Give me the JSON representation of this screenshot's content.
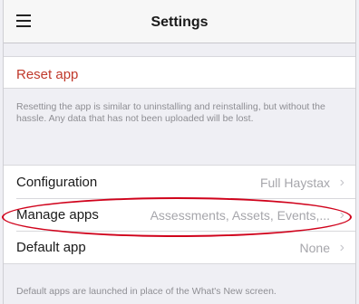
{
  "navbar": {
    "title": "Settings",
    "menu_icon": "hamburger-menu-icon"
  },
  "reset": {
    "label": "Reset app",
    "description": "Resetting the app is similar to uninstalling and reinstalling, but without the hassle. Any data that has not been uploaded will be lost."
  },
  "settings": {
    "rows": [
      {
        "label": "Configuration",
        "value": "Full Haystax"
      },
      {
        "label": "Manage apps",
        "value": "Assessments, Assets, Events,..."
      },
      {
        "label": "Default app",
        "value": "None"
      }
    ],
    "footer": "Default apps are launched in place of the What's New screen."
  },
  "annotation": {
    "color": "#d0021b"
  }
}
